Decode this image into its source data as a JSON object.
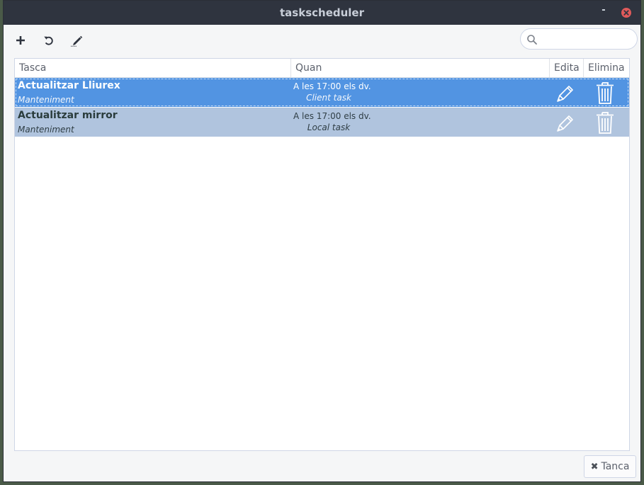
{
  "window": {
    "title": "taskscheduler",
    "minimize_glyph": "-"
  },
  "toolbar": {
    "add_icon": "plus-icon",
    "refresh_icon": "undo-icon",
    "edit_icon": "pencil-icon",
    "search_placeholder": "",
    "search_value": ""
  },
  "table": {
    "headers": {
      "task": "Tasca",
      "when": "Quan",
      "edit": "Edita",
      "delete": "Elimina"
    },
    "rows": [
      {
        "name": "Actualitzar Lliurex",
        "category": "Manteniment",
        "when": "A les 17:00 els dv.",
        "type": "Client task",
        "selected": true
      },
      {
        "name": "Actualitzar mirror",
        "category": "Manteniment",
        "when": "A les 17:00 els dv.",
        "type": "Local task",
        "selected": false
      }
    ]
  },
  "footer": {
    "close_label": "Tanca",
    "close_glyph": "✖"
  },
  "colors": {
    "titlebar": "#2f343f",
    "selected_row": "#5294e2",
    "second_row": "#b0c4de",
    "close_button": "#e05a5a"
  }
}
